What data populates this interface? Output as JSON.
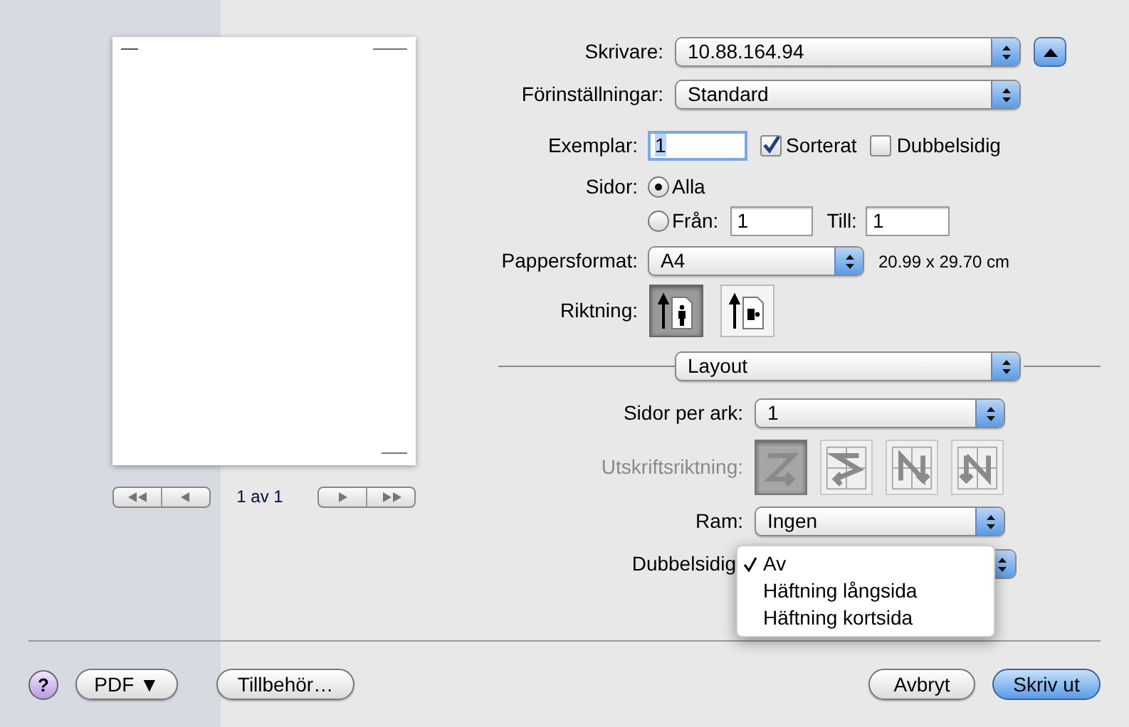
{
  "preview": {
    "page_label": "1 av 1"
  },
  "printer": {
    "label": "Skrivare:",
    "value": "10.88.164.94"
  },
  "presets": {
    "label": "Förinställningar:",
    "value": "Standard"
  },
  "copies": {
    "label": "Exemplar:",
    "value": "1"
  },
  "collated": {
    "label": "Sorterat",
    "checked": true
  },
  "two_sided": {
    "label": "Dubbelsidig",
    "checked": false
  },
  "pages": {
    "label": "Sidor:",
    "options": [
      {
        "label": "Alla",
        "selected": true
      },
      {
        "label": "Från:",
        "selected": false
      }
    ],
    "from": "1",
    "to_label": "Till:",
    "to": "1"
  },
  "paper_size": {
    "label": "Pappersformat:",
    "value": "A4",
    "dimensions": "20.99 x 29.70 cm"
  },
  "orientation": {
    "label": "Riktning:",
    "options": [
      {
        "kind": "portrait",
        "selected": true
      },
      {
        "kind": "landscape",
        "selected": false
      }
    ]
  },
  "panel": {
    "value": "Layout"
  },
  "pages_per_sheet": {
    "label": "Sidor per ark:",
    "value": "1"
  },
  "layout_direction": {
    "label": "Utskriftsriktning:",
    "disabled": true,
    "options": [
      {
        "kind": "z",
        "selected": true
      },
      {
        "kind": "s",
        "selected": false
      },
      {
        "kind": "n-reverse",
        "selected": false
      },
      {
        "kind": "n",
        "selected": false
      }
    ]
  },
  "border": {
    "label": "Ram:",
    "value": "Ingen"
  },
  "duplex": {
    "label": "Dubbelsidig",
    "menu": [
      {
        "label": "Av",
        "selected": true
      },
      {
        "label": "Häftning långsida",
        "selected": false
      },
      {
        "label": "Häftning kortsida",
        "selected": false
      }
    ]
  },
  "footer": {
    "help": "?",
    "pdf": "PDF ▼",
    "accessories": "Tillbehör…",
    "cancel": "Avbryt",
    "print": "Skriv ut"
  }
}
